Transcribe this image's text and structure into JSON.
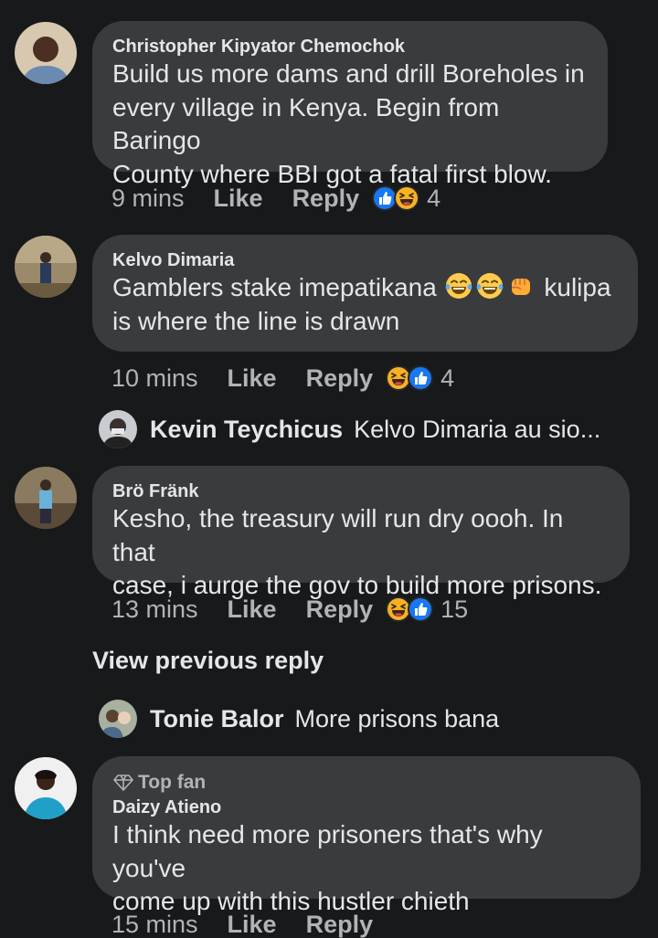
{
  "comments": [
    {
      "author": "Christopher Kipyator Chemochok",
      "text_lines": [
        "Build us more dams and drill Boreholes in",
        "every village in Kenya. Begin from Baringo",
        "County where BBI got a fatal first blow."
      ],
      "time": "9 mins",
      "like": "Like",
      "reply": "Reply",
      "reactions": [
        "like-icon",
        "laugh-icon"
      ],
      "count": "4"
    },
    {
      "author": "Kelvo Dimaria",
      "text_line1_before": "Gamblers stake imepatikana",
      "text_line1_after": "kulipa",
      "text_line2": "is where the line is drawn",
      "emojis": [
        "tears-of-joy-emoji",
        "tears-of-joy-emoji",
        "fist-emoji"
      ],
      "time": "10 mins",
      "like": "Like",
      "reply": "Reply",
      "reactions": [
        "laugh-icon",
        "like-icon"
      ],
      "count": "4"
    },
    {
      "author": "Brö Fränk",
      "text_lines": [
        "Kesho, the treasury will run dry oooh. In that",
        "case, i aurge the gov to build more prisons."
      ],
      "time": "13 mins",
      "like": "Like",
      "reply": "Reply",
      "reactions": [
        "laugh-icon",
        "like-icon"
      ],
      "count": "15"
    },
    {
      "badge": "Top fan",
      "author": "Daizy Atieno",
      "text_lines": [
        "I think need more prisoners that's why you've",
        "come up with this hustler chieth"
      ],
      "time": "15 mins",
      "like": "Like",
      "reply": "Reply"
    }
  ],
  "replies": [
    {
      "name": "Kevin Teychicus",
      "text": "Kelvo Dimaria au sio..."
    },
    {
      "name": "Tonie Balor",
      "text": "More prisons bana"
    }
  ],
  "view_previous": "View previous reply",
  "colors": {
    "background": "#18191a",
    "bubble": "#3a3b3c",
    "text": "#e4e6eb",
    "secondary": "#b0b3b8",
    "like_blue": "#1877f2",
    "emoji_yellow": "#f7b125"
  }
}
